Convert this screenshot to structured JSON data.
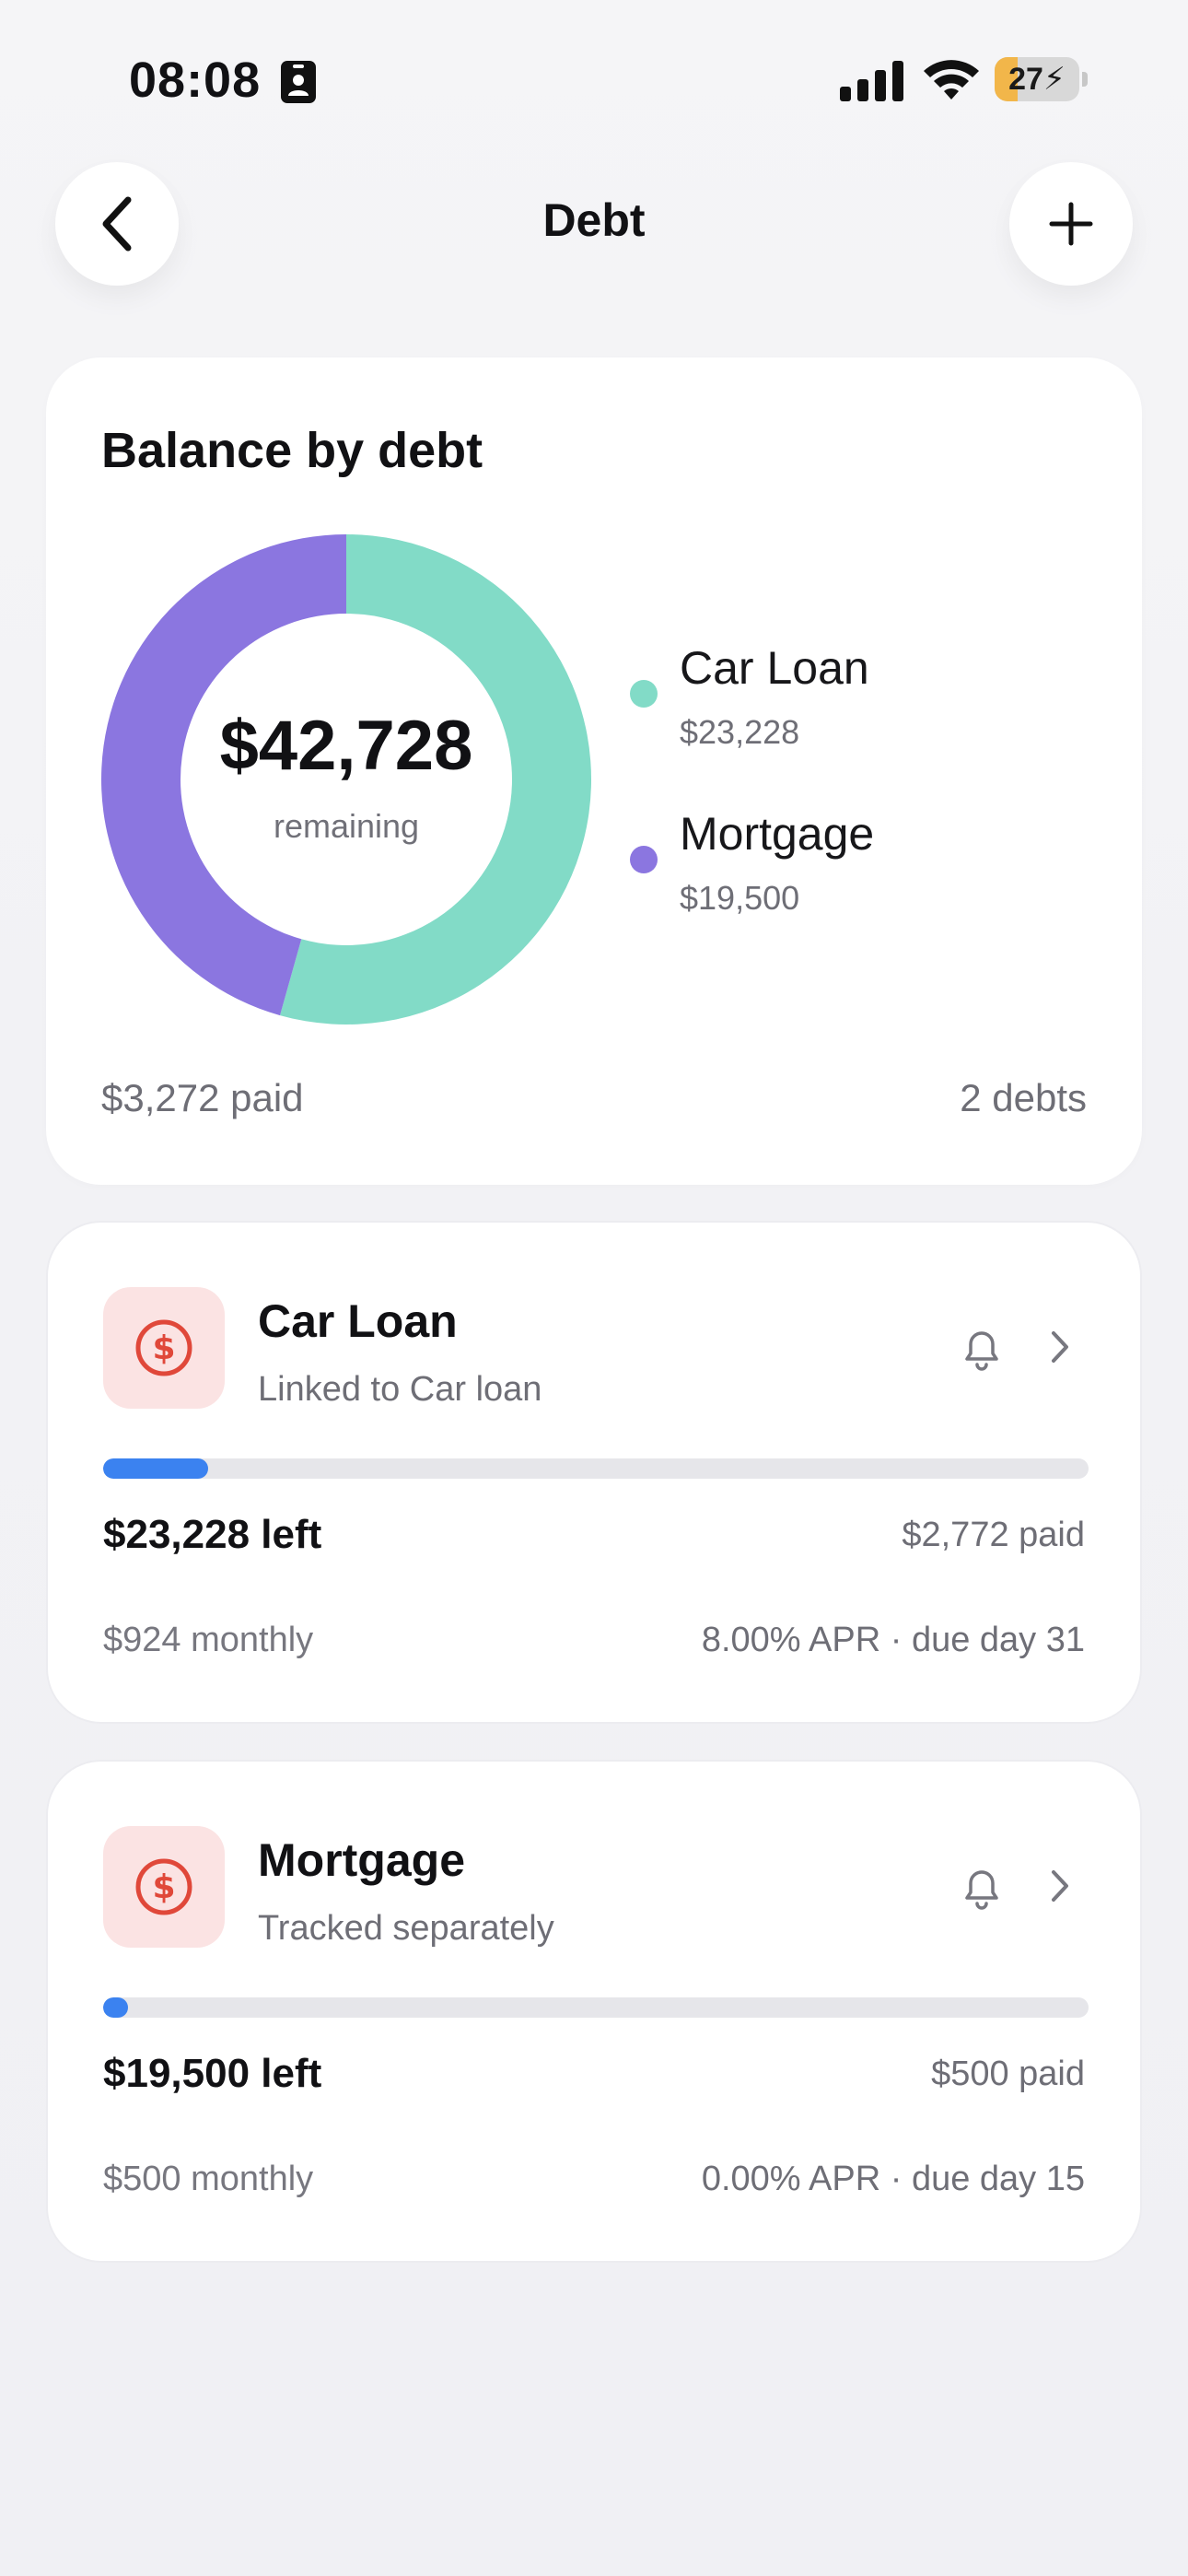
{
  "status_bar": {
    "time": "08:08",
    "battery_level": "27",
    "battery_fraction": 0.27,
    "colors": {
      "battery_fill": "#f2b64a"
    }
  },
  "nav": {
    "title": "Debt",
    "back_icon": "chevron-left-icon",
    "add_icon": "plus-icon"
  },
  "summary": {
    "title": "Balance by debt",
    "total_amount": "$42,728",
    "total_label": "remaining",
    "paid": "$3,272 paid",
    "count": "2 debts",
    "legend": [
      {
        "name": "Car Loan",
        "amount": "$23,228",
        "color": "#82dbc7"
      },
      {
        "name": "Mortgage",
        "amount": "$19,500",
        "color": "#8b76e0"
      }
    ]
  },
  "chart_data": {
    "type": "pie",
    "donut": true,
    "categories": [
      "Car Loan",
      "Mortgage"
    ],
    "values": [
      23228,
      19500
    ],
    "colors": [
      "#82dbc7",
      "#8b76e0"
    ],
    "center_text": "$42,728",
    "center_subtext": "remaining"
  },
  "debts": [
    {
      "name": "Car Loan",
      "subtitle": "Linked to Car loan",
      "left": "$23,228 left",
      "paid": "$2,772 paid",
      "monthly": "$924 monthly",
      "terms": "8.00% APR · due day 31",
      "progress_fraction": 0.107,
      "icon": "dollar-circle-icon"
    },
    {
      "name": "Mortgage",
      "subtitle": "Tracked separately",
      "left": "$19,500 left",
      "paid": "$500 paid",
      "monthly": "$500 monthly",
      "terms": "0.00% APR · due day 15",
      "progress_fraction": 0.025,
      "icon": "dollar-circle-icon"
    }
  ],
  "colors": {
    "accent_blue": "#3b82f0",
    "icon_red": "#e0483a",
    "icon_bg": "#fbe3e3"
  }
}
